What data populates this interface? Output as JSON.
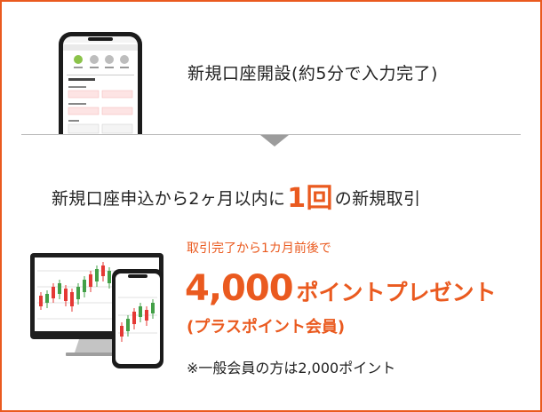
{
  "step1": {
    "text": "新規口座開設(約5分で入力完了)"
  },
  "step2": {
    "text_before": "新規口座申込から2ヶ月以内に",
    "highlight": "1回",
    "text_after": "の新規取引"
  },
  "offer": {
    "condition": "取引完了から1カ月前後で",
    "amount": "4,000",
    "present": "ポイントプレゼント",
    "plus_member": "(プラスポイント会員)",
    "note": "※一般会員の方は2,000ポイント"
  },
  "colors": {
    "accent": "#ea5a1f",
    "text": "#222222",
    "divider": "#bdbdbd",
    "arrow": "#9c9c9c"
  },
  "icons": {
    "phone_form": "smartphone-form-icon",
    "devices": "monitor-and-phone-chart-icon"
  }
}
